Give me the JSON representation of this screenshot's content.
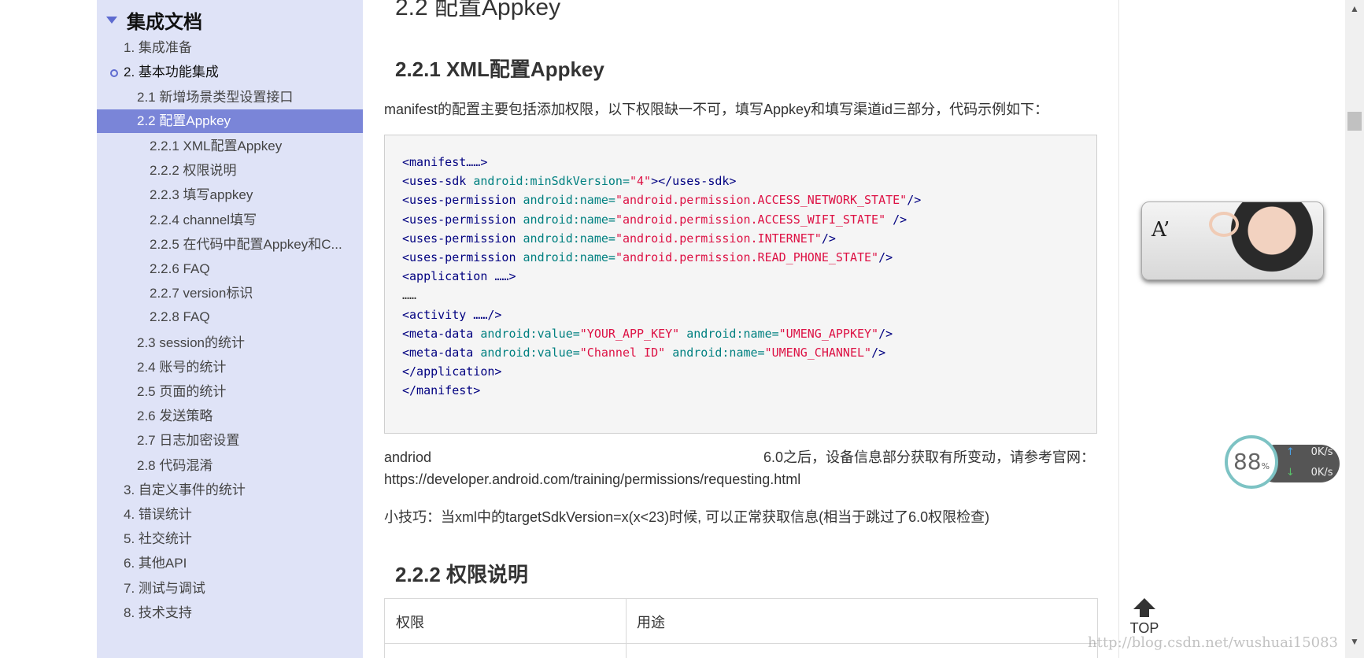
{
  "sidebar": {
    "header": "集成文档",
    "items": [
      {
        "label": "1.  集成准备"
      },
      {
        "label": "2.  基本功能集成"
      },
      {
        "label": "2.1  新增场景类型设置接口"
      },
      {
        "label": "2.2  配置Appkey"
      },
      {
        "label": "2.2.1  XML配置Appkey"
      },
      {
        "label": "2.2.2  权限说明"
      },
      {
        "label": "2.2.3  填写appkey"
      },
      {
        "label": "2.2.4  channel填写"
      },
      {
        "label": "2.2.5  在代码中配置Appkey和C..."
      },
      {
        "label": "2.2.6  FAQ"
      },
      {
        "label": "2.2.7  version标识"
      },
      {
        "label": "2.2.8  FAQ"
      },
      {
        "label": "2.3  session的统计"
      },
      {
        "label": "2.4  账号的统计"
      },
      {
        "label": "2.5  页面的统计"
      },
      {
        "label": "2.6  发送策略"
      },
      {
        "label": "2.7  日志加密设置"
      },
      {
        "label": "2.8  代码混淆"
      },
      {
        "label": "3.  自定义事件的统计"
      },
      {
        "label": "4.  错误统计"
      },
      {
        "label": "5.  社交统计"
      },
      {
        "label": "6.  其他API"
      },
      {
        "label": "7.  测试与调试"
      },
      {
        "label": "8.  技术支持"
      }
    ]
  },
  "main": {
    "h2": "2.2  配置Appkey",
    "h3_xml": "2.2.1  XML配置Appkey",
    "intro": "manifest的配置主要包括添加权限，以下权限缺一不可，填写Appkey和填写渠道id三部分，代码示例如下：",
    "code": {
      "l1": "<manifest……>",
      "l2_tag": "<uses-sdk",
      "l2_attr": "android:minSdkVersion=",
      "l2_val": "\"4\"",
      "l2_end": "></uses-sdk>",
      "perm_tag": "<uses-permission",
      "name_attr": "android:name=",
      "p1": "\"android.permission.ACCESS_NETWORK_STATE\"",
      "p2": "\"android.permission.ACCESS_WIFI_STATE\"",
      "p3": "\"android.permission.INTERNET\"",
      "p4": "\"android.permission.READ_PHONE_STATE\"",
      "close": "/>",
      "close_sp": " />",
      "app": "<application ……>",
      "dots": "……",
      "activity": "<activity ……/>",
      "meta_tag": "<meta-data",
      "value_attr": "android:value=",
      "m1_val": "\"YOUR_APP_KEY\"",
      "m1_name": "\"UMENG_APPKEY\"",
      "m2_val": "\"Channel ID\"",
      "m2_name": "\"UMENG_CHANNEL\"",
      "app_end": "</application>",
      "manifest_end": "</manifest>"
    },
    "note_left": "andriod",
    "note_right": "6.0之后，设备信息部分获取有所变动，请参考官网：",
    "note_url": "https://developer.android.com/training/permissions/requesting.html",
    "tip": "小技巧：当xml中的targetSdkVersion=x(x<23)时候, 可以正常获取信息(相当于跳过了6.0权限检查)",
    "h3_perm": "2.2.2  权限说明",
    "table": {
      "col1": "权限",
      "col2": "用途"
    }
  },
  "widgets": {
    "net_percent": "88",
    "net_percent_unit": "%",
    "upload": "0",
    "download": "0",
    "speed_unit": "K/s",
    "top_label": "TOP",
    "watermark": "http://blog.csdn.net/wushuai15083"
  }
}
